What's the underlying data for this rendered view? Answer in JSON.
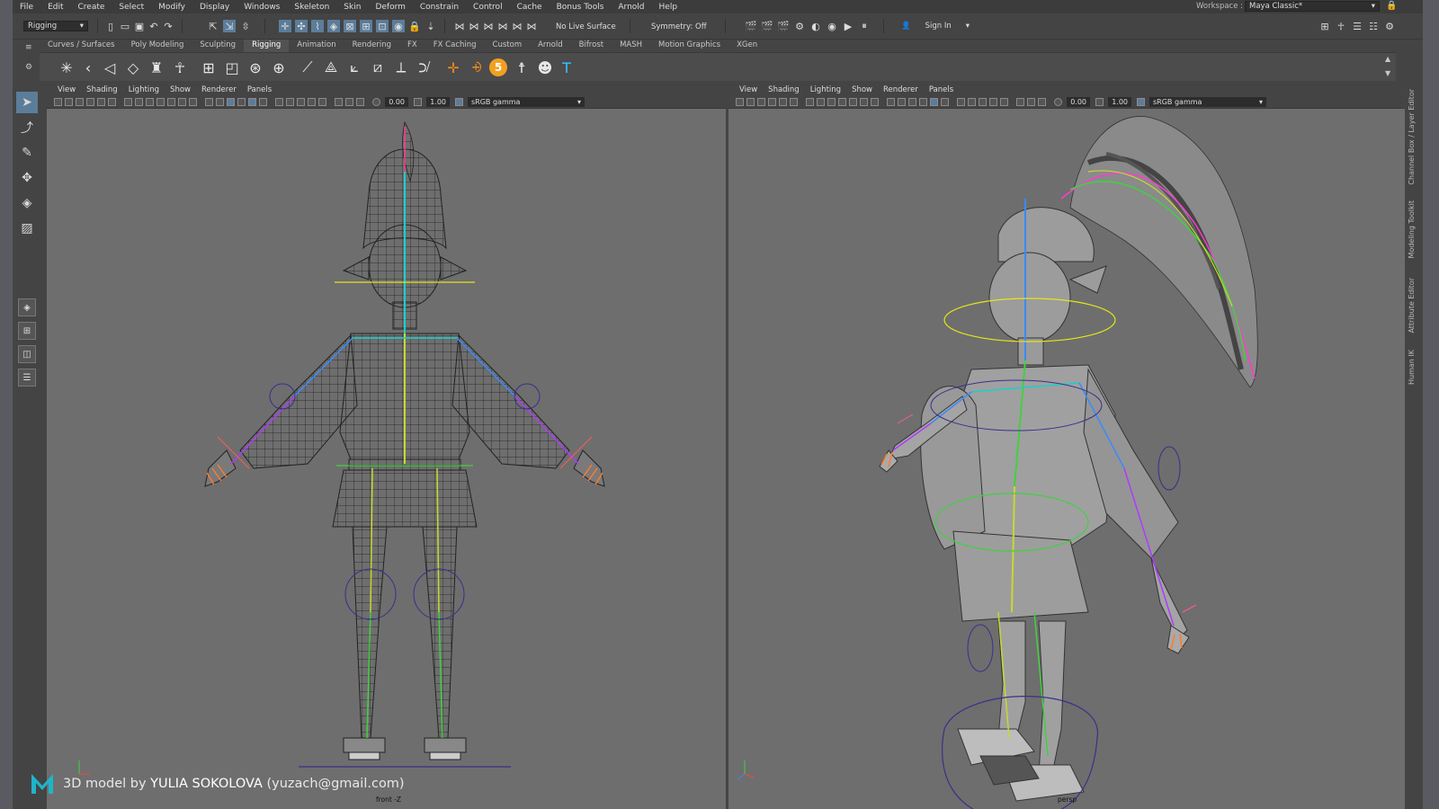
{
  "menubar": {
    "items": [
      "File",
      "Edit",
      "Create",
      "Select",
      "Modify",
      "Display",
      "Windows",
      "Skeleton",
      "Skin",
      "Deform",
      "Constrain",
      "Control",
      "Cache",
      "Bonus Tools",
      "Arnold",
      "Help"
    ],
    "workspace_label": "Workspace :",
    "workspace_value": "Maya Classic*"
  },
  "statusline": {
    "mode": "Rigging",
    "live_surface": "No Live Surface",
    "symmetry": "Symmetry: Off",
    "sign_in": "Sign In"
  },
  "shelf": {
    "tabs": [
      "Curves / Surfaces",
      "Poly Modeling",
      "Sculpting",
      "Rigging",
      "Animation",
      "Rendering",
      "FX",
      "FX Caching",
      "Custom",
      "Arnold",
      "Bifrost",
      "MASH",
      "Motion Graphics",
      "XGen"
    ],
    "active_tab": "Rigging"
  },
  "viewport_left": {
    "menu": [
      "View",
      "Shading",
      "Lighting",
      "Show",
      "Renderer",
      "Panels"
    ],
    "exposure": "0.00",
    "gamma_value": "1.00",
    "color_space": "sRGB gamma",
    "camera": "front -Z"
  },
  "viewport_right": {
    "menu": [
      "View",
      "Shading",
      "Lighting",
      "Show",
      "Renderer",
      "Panels"
    ],
    "exposure": "0.00",
    "gamma_value": "1.00",
    "color_space": "sRGB gamma",
    "camera": "persp"
  },
  "side_tabs": [
    "Channel Box / Layer Editor",
    "Modeling Toolkit",
    "Attribute Editor",
    "Human IK"
  ],
  "credit": {
    "prefix": "3D model by ",
    "author": "YULIA SOKOLOVA",
    "email": "(yuzach@gmail.com)"
  },
  "colors": {
    "selection_blue": "#5b7d9a",
    "viewport_bg": "#6e6e6e",
    "ui_dark": "#444444"
  }
}
